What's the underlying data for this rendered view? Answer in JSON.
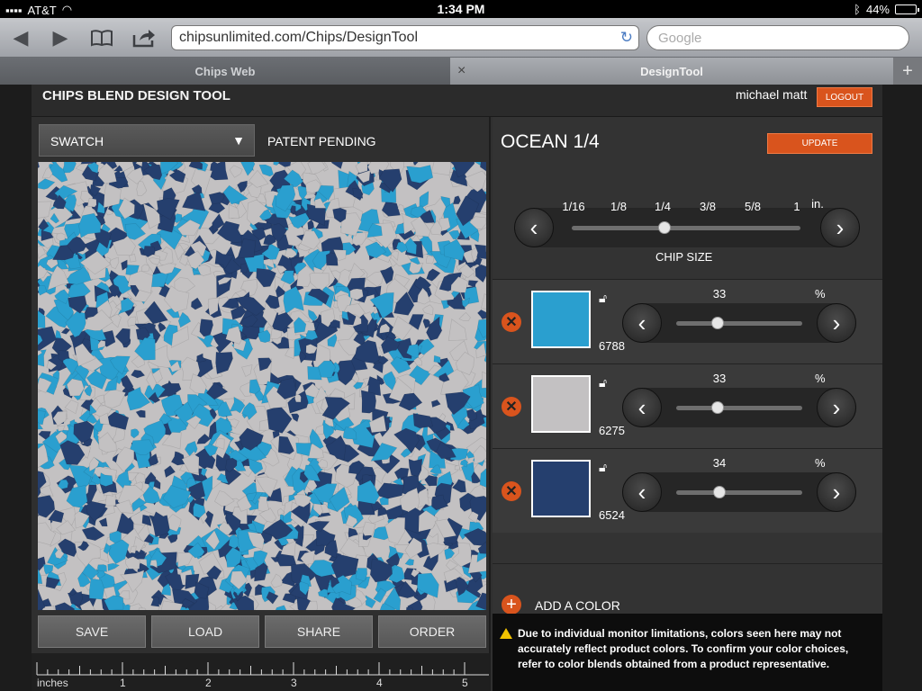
{
  "status_bar": {
    "carrier": "AT&T",
    "time": "1:34 PM",
    "battery": "44%",
    "battery_level": 0.44
  },
  "browser": {
    "url": "chipsunlimited.com/Chips/DesignTool",
    "search_placeholder": "Google",
    "tabs": [
      {
        "label": "Chips Web",
        "active": false
      },
      {
        "label": "DesignTool",
        "active": true
      }
    ],
    "tab_close": "×",
    "tab_add": "+"
  },
  "app": {
    "title": "CHIPS BLEND DESIGN TOOL",
    "user": "michael matt",
    "logout_label": "LOGOUT"
  },
  "left_panel": {
    "view_select": "SWATCH",
    "patent": "PATENT PENDING",
    "actions": [
      "SAVE",
      "LOAD",
      "SHARE",
      "ORDER"
    ],
    "ruler": {
      "unit_label": "inches",
      "labels": [
        "1",
        "2",
        "3",
        "4",
        "5"
      ]
    }
  },
  "right_panel": {
    "blend_name": "OCEAN 1/4",
    "update_label": "UPDATE",
    "chip_size": {
      "options": [
        "1/16",
        "1/8",
        "1/4",
        "3/8",
        "5/8",
        "1"
      ],
      "unit": "in.",
      "selected": "1/4",
      "label": "CHIP SIZE"
    },
    "colors": [
      {
        "code": "6788",
        "percent": "33",
        "hex": "#2a9fcf"
      },
      {
        "code": "6275",
        "percent": "33",
        "hex": "#c3c1c2"
      },
      {
        "code": "6524",
        "percent": "34",
        "hex": "#253f6e"
      }
    ],
    "percent_sign": "%",
    "add_color_label": "ADD A COLOR",
    "disclaimer": "Due to individual monitor limitations, colors seen here may not accurately reflect product colors. To confirm your color choices, refer to color blends obtained from a product representative."
  }
}
